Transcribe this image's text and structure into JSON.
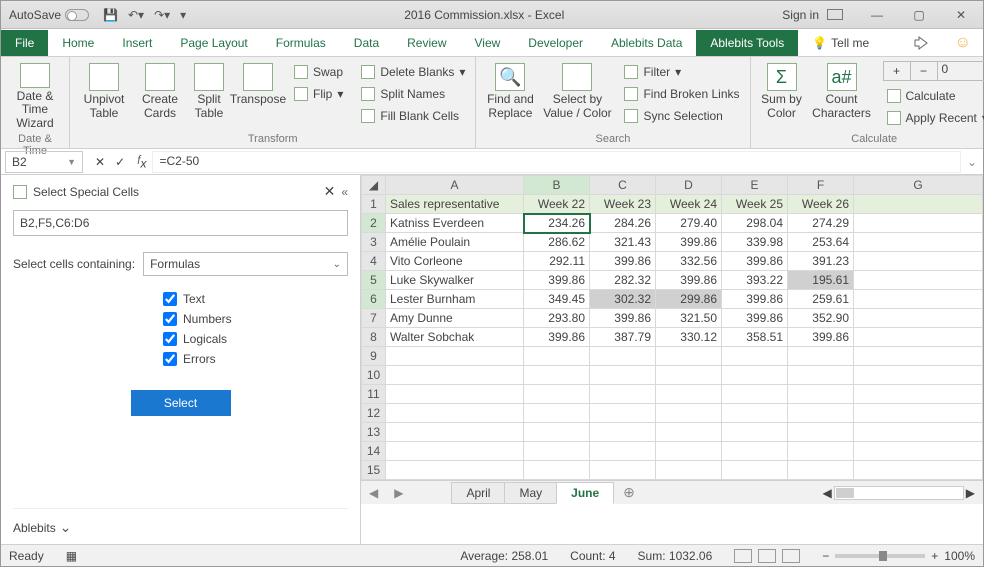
{
  "titlebar": {
    "autosave": "AutoSave",
    "title": "2016 Commission.xlsx - Excel",
    "signin": "Sign in"
  },
  "tabs": [
    "File",
    "Home",
    "Insert",
    "Page Layout",
    "Formulas",
    "Data",
    "Review",
    "View",
    "Developer",
    "Ablebits Data",
    "Ablebits Tools"
  ],
  "tell": "Tell me",
  "ribbon": {
    "datetime": {
      "btn": "Date &\nTime Wizard",
      "label": "Date & Time"
    },
    "transform": {
      "label": "Transform",
      "unpivot": "Unpivot\nTable",
      "create": "Create\nCards",
      "split": "Split\nTable",
      "transpose": "Transpose",
      "swap": "Swap",
      "flip": "Flip",
      "delblanks": "Delete Blanks",
      "splitnames": "Split Names",
      "fillblank": "Fill Blank Cells"
    },
    "search": {
      "label": "Search",
      "find": "Find and\nReplace",
      "selby": "Select by\nValue / Color",
      "filter": "Filter",
      "broken": "Find Broken Links",
      "sync": "Sync Selection"
    },
    "calculate": {
      "label": "Calculate",
      "sumby": "Sum by\nColor",
      "count": "Count\nCharacters",
      "decval": "0",
      "calc": "Calculate",
      "apply": "Apply Recent"
    }
  },
  "fx": {
    "name": "B2",
    "formula": "=C2-50"
  },
  "taskpane": {
    "title": "Select Special Cells",
    "range": "B2,F5,C6:D6",
    "label": "Select cells containing:",
    "mode": "Formulas",
    "checks": [
      "Text",
      "Numbers",
      "Logicals",
      "Errors"
    ],
    "btn": "Select",
    "brand": "Ablebits"
  },
  "cols": [
    "A",
    "B",
    "C",
    "D",
    "E",
    "F",
    "G"
  ],
  "rows": [
    "1",
    "2",
    "3",
    "4",
    "5",
    "6",
    "7",
    "8",
    "9",
    "10",
    "11",
    "12",
    "13",
    "14",
    "15"
  ],
  "header": [
    "Sales representative",
    "Week 22",
    "Week 23",
    "Week 24",
    "Week 25",
    "Week 26"
  ],
  "data": [
    [
      "Katniss Everdeen",
      "234.26",
      "284.26",
      "279.40",
      "298.04",
      "274.29"
    ],
    [
      "Amélie Poulain",
      "286.62",
      "321.43",
      "399.86",
      "339.98",
      "253.64"
    ],
    [
      "Vito Corleone",
      "292.11",
      "399.86",
      "332.56",
      "399.86",
      "391.23"
    ],
    [
      "Luke Skywalker",
      "399.86",
      "282.32",
      "399.86",
      "393.22",
      "195.61"
    ],
    [
      "Lester Burnham",
      "349.45",
      "302.32",
      "299.86",
      "399.86",
      "259.61"
    ],
    [
      "Amy Dunne",
      "293.80",
      "399.86",
      "321.50",
      "399.86",
      "352.90"
    ],
    [
      "Walter Sobchak",
      "399.86",
      "387.79",
      "330.12",
      "358.51",
      "399.86"
    ]
  ],
  "sheets": [
    "April",
    "May",
    "June"
  ],
  "status": {
    "ready": "Ready",
    "avg": "Average: 258.01",
    "count": "Count: 4",
    "sum": "Sum: 1032.06",
    "zoom": "100%"
  }
}
